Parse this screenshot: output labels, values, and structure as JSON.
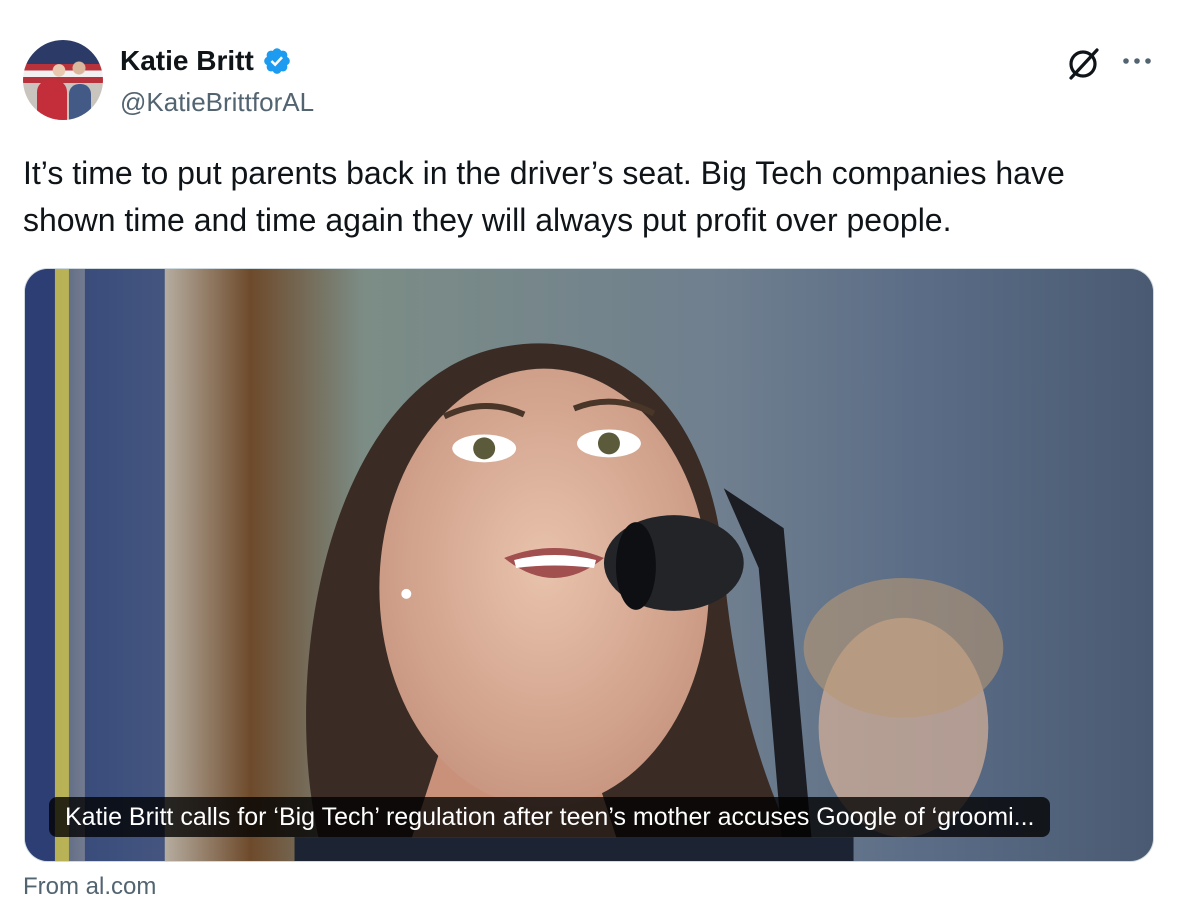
{
  "author": {
    "name": "Katie Britt",
    "handle": "@KatieBrittforAL",
    "verified": true
  },
  "icons": {
    "verified": "verified-badge-icon",
    "grok": "grok-icon",
    "more": "more-options-icon"
  },
  "tweet": {
    "text": "It’s time to put parents back in the driver’s seat. Big Tech companies have shown time and time again they will always put profit over people."
  },
  "link_card": {
    "headline": "Katie Britt calls for ‘Big Tech’ regulation after teen’s mother accuses Google of ‘groomi...",
    "source": "From al.com"
  },
  "colors": {
    "verified_blue": "#1d9bf0",
    "text_primary": "#0f1419",
    "text_secondary": "#536471",
    "border": "#cfd9de"
  }
}
